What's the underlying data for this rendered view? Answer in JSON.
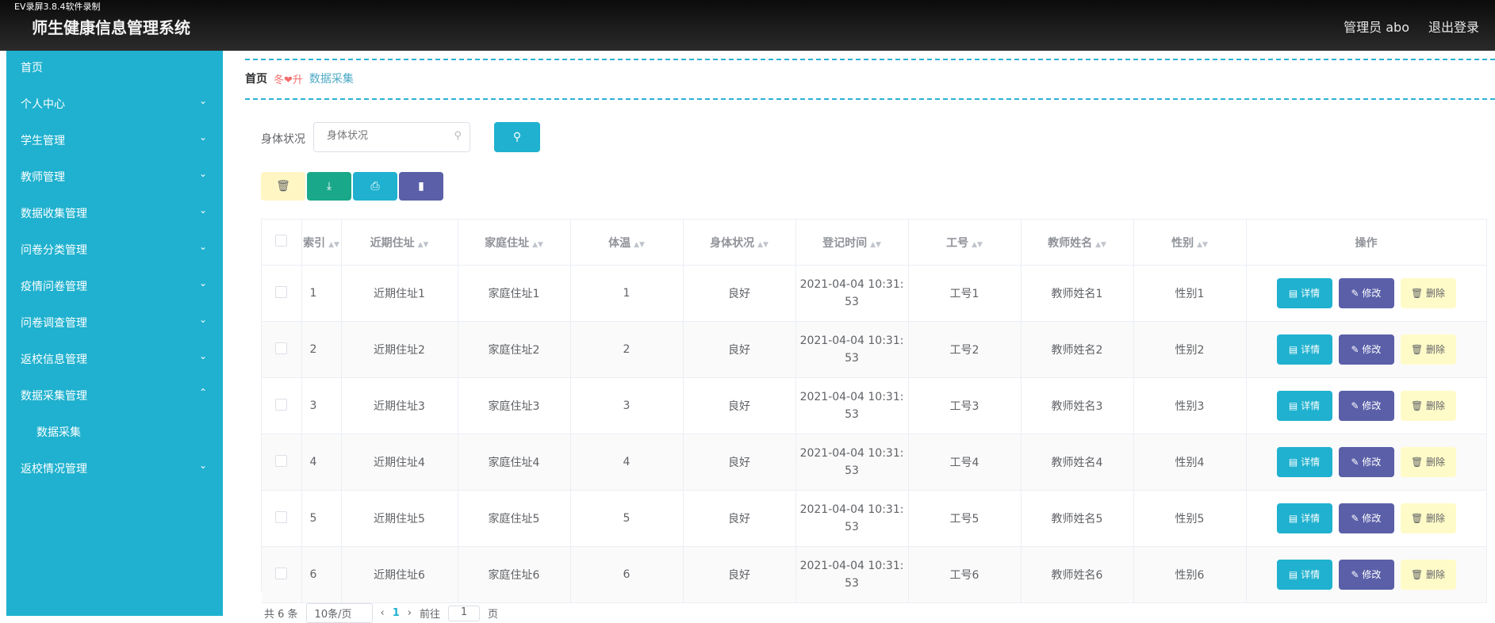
{
  "recorder": "EV录屏3.8.4软件录制",
  "header": {
    "title": "师生健康信息管理系统",
    "admin_label": "管理员 abo",
    "logout_label": "退出登录"
  },
  "sidebar": {
    "items": [
      {
        "label": "首页",
        "chevron": ""
      },
      {
        "label": "个人中心",
        "chevron": "⌄"
      },
      {
        "label": "学生管理",
        "chevron": "⌄"
      },
      {
        "label": "教师管理",
        "chevron": "⌄"
      },
      {
        "label": "数据收集管理",
        "chevron": "⌄"
      },
      {
        "label": "问卷分类管理",
        "chevron": "⌄"
      },
      {
        "label": "疫情问卷管理",
        "chevron": "⌄"
      },
      {
        "label": "问卷调查管理",
        "chevron": "⌄"
      },
      {
        "label": "返校信息管理",
        "chevron": "⌄"
      },
      {
        "label": "数据采集管理",
        "chevron": "⌃"
      },
      {
        "label": "数据采集",
        "chevron": ""
      },
      {
        "label": "返校情况管理",
        "chevron": "⌄"
      }
    ]
  },
  "breadcrumb": {
    "home": "首页",
    "separator": "冬❤升",
    "current": "数据采集"
  },
  "search": {
    "label": "身体状况",
    "placeholder": "身体状况",
    "button_icon": "search-icon"
  },
  "toolbar": {
    "colors": {
      "delete": "#fff6c4",
      "download": "#19a889",
      "print": "#1fb1cf",
      "chart": "#5a5fa8"
    },
    "delete_icon": "🗑",
    "download_icon": "⤓",
    "print_icon": "⎙",
    "chart_icon": "▮"
  },
  "table": {
    "headers": [
      "索引",
      "近期住址",
      "家庭住址",
      "体温",
      "身体状况",
      "登记时间",
      "工号",
      "教师姓名",
      "性别",
      "操作"
    ],
    "rows": [
      {
        "idx": "1",
        "recent": "近期住址1",
        "home": "家庭住址1",
        "temp": "1",
        "status": "良好",
        "time1": "2021-04-04 10:31:",
        "time2": "53",
        "job": "工号1",
        "name": "教师姓名1",
        "sex": "性别1"
      },
      {
        "idx": "2",
        "recent": "近期住址2",
        "home": "家庭住址2",
        "temp": "2",
        "status": "良好",
        "time1": "2021-04-04 10:31:",
        "time2": "53",
        "job": "工号2",
        "name": "教师姓名2",
        "sex": "性别2"
      },
      {
        "idx": "3",
        "recent": "近期住址3",
        "home": "家庭住址3",
        "temp": "3",
        "status": "良好",
        "time1": "2021-04-04 10:31:",
        "time2": "53",
        "job": "工号3",
        "name": "教师姓名3",
        "sex": "性别3"
      },
      {
        "idx": "4",
        "recent": "近期住址4",
        "home": "家庭住址4",
        "temp": "4",
        "status": "良好",
        "time1": "2021-04-04 10:31:",
        "time2": "53",
        "job": "工号4",
        "name": "教师姓名4",
        "sex": "性别4"
      },
      {
        "idx": "5",
        "recent": "近期住址5",
        "home": "家庭住址5",
        "temp": "5",
        "status": "良好",
        "time1": "2021-04-04 10:31:",
        "time2": "53",
        "job": "工号5",
        "name": "教师姓名5",
        "sex": "性别5"
      },
      {
        "idx": "6",
        "recent": "近期住址6",
        "home": "家庭住址6",
        "temp": "6",
        "status": "良好",
        "time1": "2021-04-04 10:31:",
        "time2": "53",
        "job": "工号6",
        "name": "教师姓名6",
        "sex": "性别6"
      }
    ],
    "ops": {
      "detail": "详情",
      "edit": "修改",
      "delete": "删除"
    }
  },
  "pagination": {
    "total": "共 6 条",
    "page_size": "10条/页",
    "prev": "‹",
    "current": "1",
    "next": "›",
    "goto_prefix": "前往",
    "goto_value": "1",
    "goto_suffix": "页"
  }
}
